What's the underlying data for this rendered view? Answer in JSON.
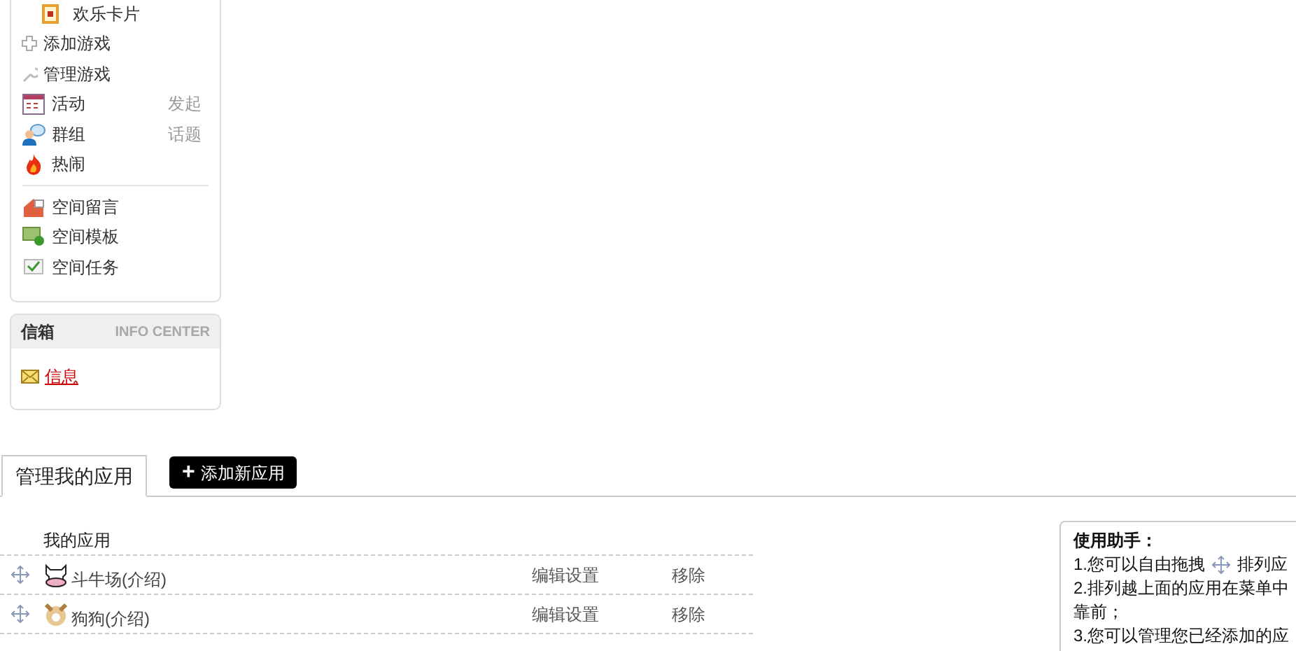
{
  "sidebar": {
    "items": [
      {
        "kind": "sub",
        "label": "欢乐卡片"
      },
      {
        "kind": "plain",
        "label": "添加游戏"
      },
      {
        "kind": "plain",
        "label": "管理游戏"
      },
      {
        "kind": "action",
        "label": "活动",
        "action": "发起"
      },
      {
        "kind": "action",
        "label": "群组",
        "action": "话题"
      },
      {
        "kind": "action",
        "label": "热闹"
      },
      {
        "kind": "divider"
      },
      {
        "kind": "action",
        "label": "空间留言"
      },
      {
        "kind": "action",
        "label": "空间模板"
      },
      {
        "kind": "action",
        "label": "空间任务"
      }
    ]
  },
  "inbox": {
    "title": "信箱",
    "subtitle": "INFO CENTER",
    "link": "信息"
  },
  "tabs": [
    {
      "label": "管理我的应用",
      "selected": true
    }
  ],
  "add_button": {
    "icon": "+",
    "label": "添加新应用"
  },
  "apps": {
    "heading": "我的应用",
    "rows": [
      {
        "name": "斗牛场(介绍)",
        "edit": "编辑设置",
        "remove": "移除"
      },
      {
        "name": "狗狗(介绍)",
        "edit": "编辑设置",
        "remove": "移除"
      }
    ]
  },
  "help": {
    "title": "使用助手：",
    "lines": [
      {
        "kind": "with_icon",
        "before": "1.您可以自由拖拽",
        "after": "排列应"
      },
      {
        "kind": "text",
        "before": "2.排列越上面的应用在菜单中"
      },
      {
        "kind": "text",
        "before": "靠前；"
      },
      {
        "kind": "text",
        "before": "3.您可以管理您已经添加的应"
      }
    ]
  }
}
